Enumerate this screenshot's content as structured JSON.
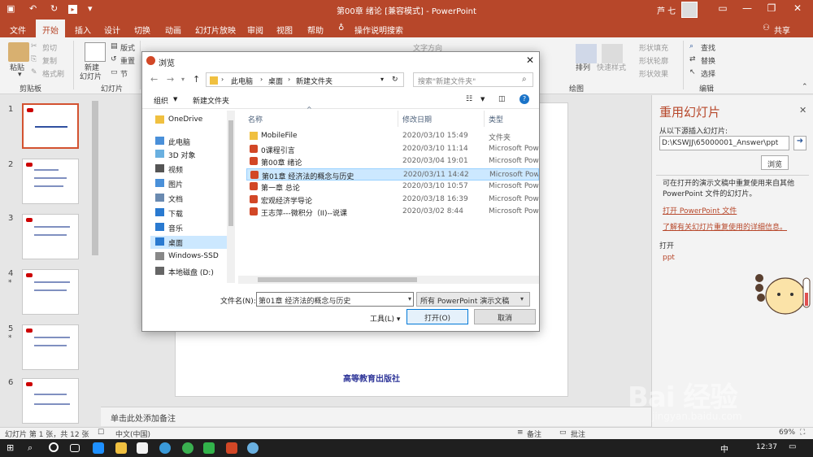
{
  "titlebar": {
    "title": "第00章  绪论 [兼容模式]  -  PowerPoint",
    "user": "芦 七"
  },
  "tabs": [
    "文件",
    "开始",
    "插入",
    "设计",
    "切换",
    "动画",
    "幻灯片放映",
    "审阅",
    "视图",
    "帮助",
    "操作说明搜索",
    "共享"
  ],
  "ribbon": {
    "paste": "粘贴",
    "cut": "剪切",
    "copy": "复制",
    "format_painter": "格式刷",
    "clipboard_group": "剪贴板",
    "new_slide": "新建",
    "new_slide2": "幻灯片",
    "layout": "版式",
    "reset": "重置",
    "section": "节",
    "slides_group": "幻灯片",
    "text_direction": "文字方向",
    "arrange": "排列",
    "quick_styles": "快速样式",
    "shape_fill": "形状填充",
    "shape_outline": "形状轮廓",
    "shape_effects": "形状效果",
    "drawing_group": "绘图",
    "find": "查找",
    "replace": "替换",
    "select": "选择",
    "editing_group": "编辑"
  },
  "thumbnails": [
    {
      "num": "1",
      "star": ""
    },
    {
      "num": "2",
      "star": ""
    },
    {
      "num": "3",
      "star": ""
    },
    {
      "num": "4",
      "star": "*"
    },
    {
      "num": "5",
      "star": "*"
    },
    {
      "num": "6",
      "star": ""
    }
  ],
  "slide": {
    "publisher": "高等教育出版社"
  },
  "notes_placeholder": "单击此处添加备注",
  "reuse_pane": {
    "title": "重用幻灯片",
    "from_label": "从以下源插入幻灯片:",
    "path": "D:\\KSWJJ\\65000001_Answer\\ppt",
    "browse": "浏览",
    "info": "可在打开的演示文稿中重复使用来自其他 PowerPoint 文件的幻灯片。",
    "open_link": "打开 PowerPoint 文件",
    "more_link": "了解有关幻灯片重复使用的详细信息。",
    "open_label": "打开",
    "ppt": "ppt"
  },
  "status": {
    "slide_info": "幻灯片 第 1 张，共 12 张",
    "language": "中文(中国)",
    "notes": "备注",
    "comments": "批注",
    "zoom": "69%"
  },
  "taskbar": {
    "time": "12:37",
    "ime": "中"
  },
  "dialog": {
    "title": "浏览",
    "breadcrumbs": [
      "此电脑",
      "桌面",
      "新建文件夹"
    ],
    "search_placeholder": "搜索\"新建文件夹\"",
    "organize": "组织",
    "new_folder": "新建文件夹",
    "nav_items": [
      {
        "label": "OneDrive",
        "icon": "onedrive-icon",
        "color": "#f0c040"
      },
      {
        "label": "此电脑",
        "icon": "computer-icon",
        "color": "#4a90d9"
      },
      {
        "label": "3D 对象",
        "icon": "3d-objects-icon",
        "color": "#6ab0e0"
      },
      {
        "label": "视频",
        "icon": "video-icon",
        "color": "#555555"
      },
      {
        "label": "图片",
        "icon": "pictures-icon",
        "color": "#4a90d9"
      },
      {
        "label": "文档",
        "icon": "documents-icon",
        "color": "#6a8ab0"
      },
      {
        "label": "下载",
        "icon": "downloads-icon",
        "color": "#2a7ad0"
      },
      {
        "label": "音乐",
        "icon": "music-icon",
        "color": "#2a7ad0"
      },
      {
        "label": "桌面",
        "icon": "desktop-icon",
        "color": "#2a7ad0"
      },
      {
        "label": "Windows-SSD",
        "icon": "drive-icon",
        "color": "#888888"
      },
      {
        "label": "本地磁盘 (D:)",
        "icon": "drive-icon",
        "color": "#666666"
      }
    ],
    "columns": [
      "名称",
      "修改日期",
      "类型"
    ],
    "files": [
      {
        "name": "MobileFile",
        "date": "2020/03/10 15:49",
        "type": "文件夹",
        "kind": "folder"
      },
      {
        "name": "0课程引言",
        "date": "2020/03/10 11:14",
        "type": "Microsoft PowerPoint",
        "kind": "ppt"
      },
      {
        "name": "第00章  绪论",
        "date": "2020/03/04 19:01",
        "type": "Microsoft PowerPoint",
        "kind": "ppt"
      },
      {
        "name": "第01章  经济法的概念与历史",
        "date": "2020/03/11 14:42",
        "type": "Microsoft PowerPoint",
        "kind": "ppt"
      },
      {
        "name": "第一章  总论",
        "date": "2020/03/10 10:57",
        "type": "Microsoft PowerPoint",
        "kind": "ppt"
      },
      {
        "name": "宏观经济学导论",
        "date": "2020/03/18 16:39",
        "type": "Microsoft PowerPoint",
        "kind": "ppt"
      },
      {
        "name": "王志萍---微积分（II)--说课",
        "date": "2020/03/02 8:44",
        "type": "Microsoft PowerPoint",
        "kind": "ppt"
      }
    ],
    "filename_label": "文件名(N):",
    "filename_value": "第01章  经济法的概念与历史",
    "filetype_value": "所有 PowerPoint 演示文稿",
    "tools": "工具(L)",
    "open_btn": "打开(O)",
    "cancel_btn": "取消"
  },
  "watermark": {
    "text": "Bai 经验",
    "url": "jingyan.baidu.com"
  },
  "colors": {
    "accent": "#b7472a",
    "selection": "#cce8ff"
  }
}
